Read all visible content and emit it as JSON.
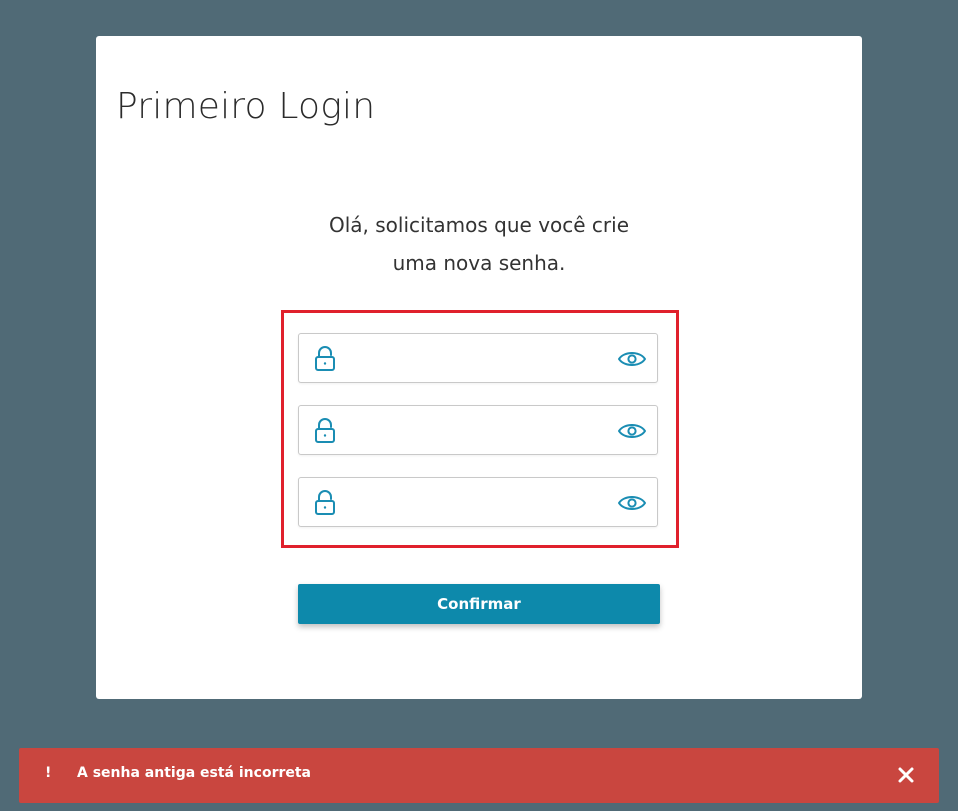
{
  "page": {
    "title": "Primeiro Login",
    "intro_line1": "Olá, solicitamos que você crie",
    "intro_line2": "uma nova senha."
  },
  "form": {
    "fields": [
      {
        "value": "",
        "placeholder": "",
        "icon": "lock-icon",
        "toggle_icon": "eye-icon"
      },
      {
        "value": "",
        "placeholder": "",
        "icon": "lock-icon",
        "toggle_icon": "eye-icon"
      },
      {
        "value": "",
        "placeholder": "",
        "icon": "lock-icon",
        "toggle_icon": "eye-icon"
      }
    ],
    "submit_label": "Confirmar"
  },
  "toast": {
    "icon": "!",
    "message": "A senha antiga está incorreta",
    "close_icon": "close-icon"
  },
  "colors": {
    "background": "#506a76",
    "accent": "#0d89ab",
    "highlight_border": "#e0202c",
    "toast_background": "#c9463f"
  }
}
